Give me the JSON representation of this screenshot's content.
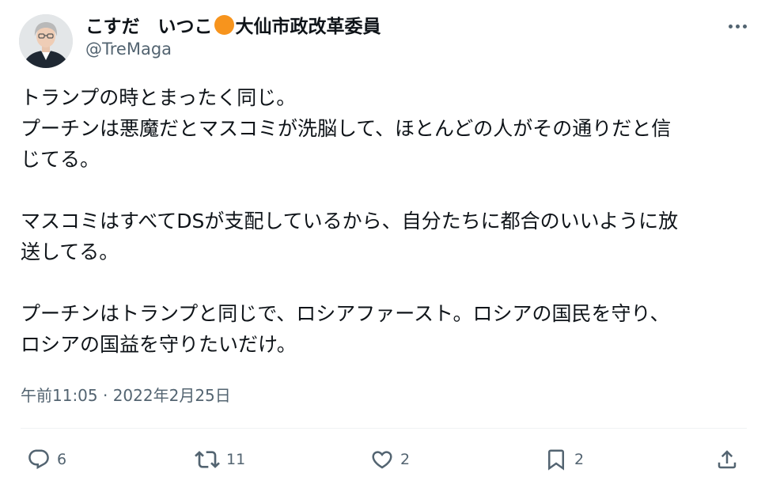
{
  "author": {
    "name_prefix": "こすだ　いつこ",
    "name_suffix": "大仙市政改革委員",
    "handle": "@TreMaga"
  },
  "tweet": {
    "lines": [
      "トランプの時とまったく同じ。",
      "プーチンは悪魔だとマスコミが洗脳して、ほとんどの人がその通りだと信",
      "じてる。",
      "",
      "マスコミはすべてDSが支配しているから、自分たちに都合のいいように放",
      "送してる。",
      "",
      "プーチンはトランプと同じで、ロシアファースト。ロシアの国民を守り、",
      "ロシアの国益を守りたいだけ。"
    ],
    "timestamp": "午前11:05 · 2022年2月25日"
  },
  "actions": {
    "reply_count": "6",
    "retweet_count": "11",
    "like_count": "2",
    "bookmark_count": "2"
  },
  "icons": {
    "more": "more-options-icon",
    "reply": "reply-icon",
    "retweet": "retweet-icon",
    "like": "heart-icon",
    "bookmark": "bookmark-icon",
    "share": "share-icon"
  },
  "colors": {
    "accent_dot": "#f7941d",
    "text_primary": "#0f1419",
    "text_secondary": "#536471",
    "divider": "#eff3f4"
  }
}
